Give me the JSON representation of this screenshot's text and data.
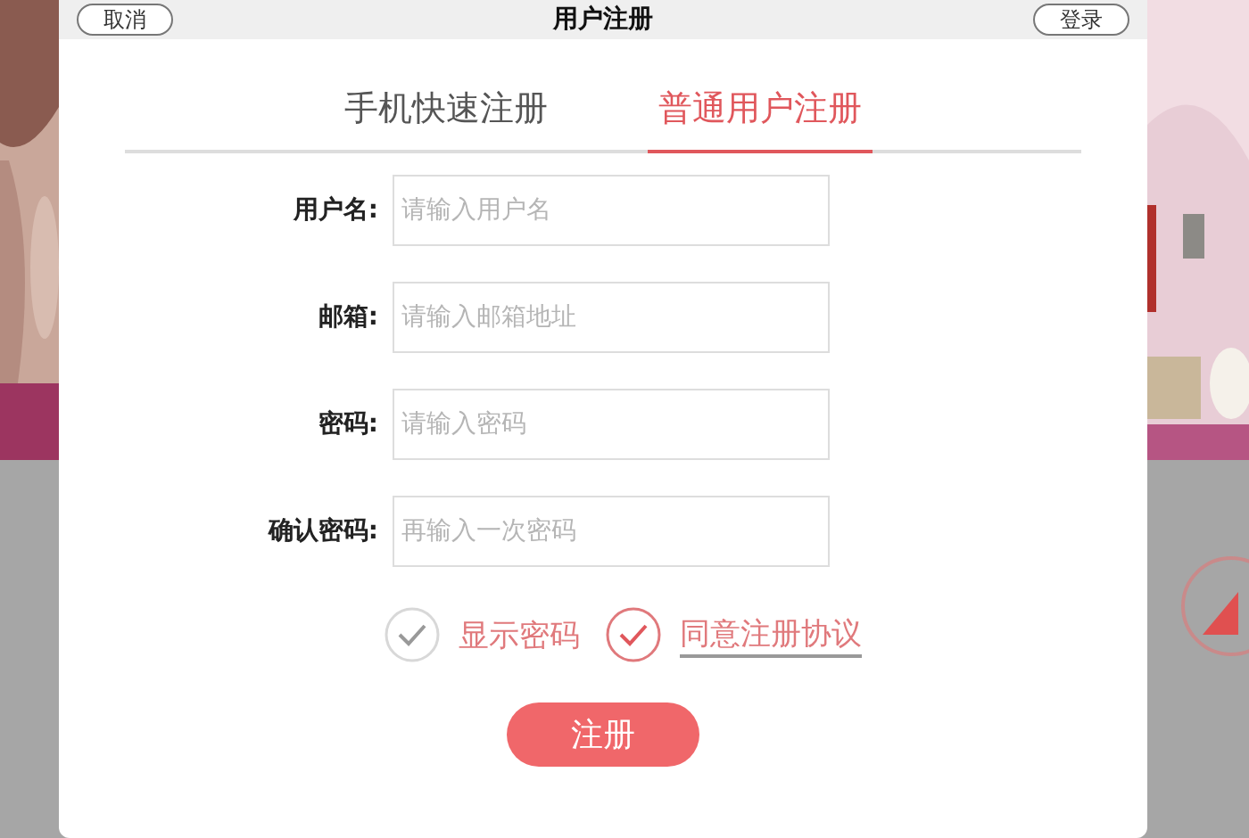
{
  "header": {
    "cancel": "取消",
    "title": "用户注册",
    "login": "登录"
  },
  "tabs": [
    {
      "label": "手机快速注册",
      "selected": false
    },
    {
      "label": "普通用户注册",
      "selected": true
    }
  ],
  "fields": [
    {
      "label": "用户名:",
      "placeholder": "请输入用户名"
    },
    {
      "label": "邮箱:",
      "placeholder": "请输入邮箱地址"
    },
    {
      "label": "密码:",
      "placeholder": "请输入密码"
    },
    {
      "label": "确认密码:",
      "placeholder": "再输入一次密码"
    }
  ],
  "options": [
    {
      "kind": "toggle",
      "label": "显示密码",
      "checked": false
    },
    {
      "kind": "agreement",
      "label": "同意注册协议",
      "checked": true
    }
  ],
  "submit": "注册"
}
